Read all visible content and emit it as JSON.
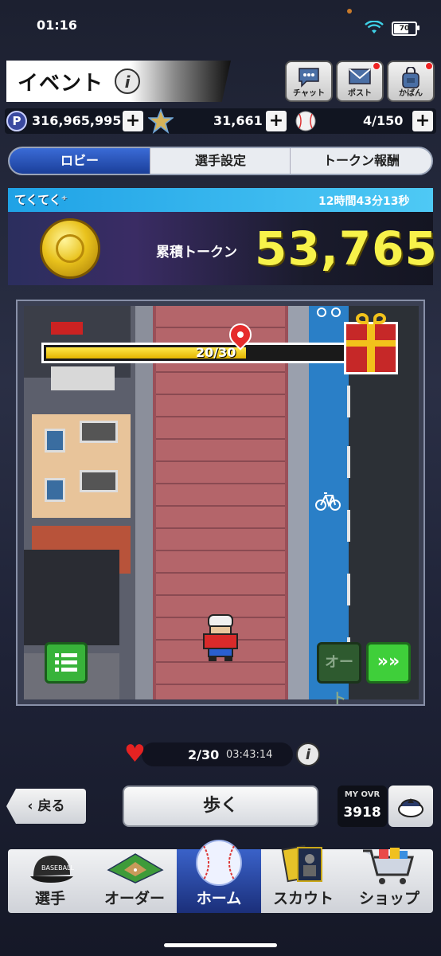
{
  "status_bar": {
    "time": "01:16",
    "battery": "70"
  },
  "header": {
    "title": "イベント",
    "info_icon": "i",
    "buttons": [
      {
        "label": "チャット",
        "icon": "chat-icon"
      },
      {
        "label": "ポスト",
        "icon": "mail-icon"
      },
      {
        "label": "かばん",
        "icon": "bag-icon"
      }
    ]
  },
  "currencies": {
    "points": "316,965,995",
    "points_icon": "P",
    "stars": "31,661",
    "balls": "4/150",
    "plus": "+"
  },
  "tabs": [
    {
      "label": "ロビー",
      "active": true
    },
    {
      "label": "選手設定",
      "active": false
    },
    {
      "label": "トークン報酬",
      "active": false
    }
  ],
  "event": {
    "name": "てくてく⁺",
    "timer": "12時間43分13秒",
    "token_label": "累積トークン",
    "token_value": "53,765"
  },
  "walk_map": {
    "progress_text": "20/30",
    "progress_fraction": 0.667,
    "auto_label": "オート",
    "fast_forward": "»»"
  },
  "walk_status": {
    "count": "2/30",
    "time": "03:43:14",
    "info_icon": "i"
  },
  "actions": {
    "back_label": "‹ 戻る",
    "walk_label": "歩く",
    "ovr_label": "MY OVR",
    "ovr_value": "3918"
  },
  "bottom_nav": [
    {
      "label": "選手",
      "icon": "baseball-cap-icon",
      "active": false
    },
    {
      "label": "オーダー",
      "icon": "baseball-field-icon",
      "active": false
    },
    {
      "label": "ホーム",
      "icon": "baseball-icon",
      "active": true
    },
    {
      "label": "スカウト",
      "icon": "player-cards-icon",
      "active": false
    },
    {
      "label": "ショップ",
      "icon": "shopping-cart-icon",
      "active": false
    }
  ]
}
